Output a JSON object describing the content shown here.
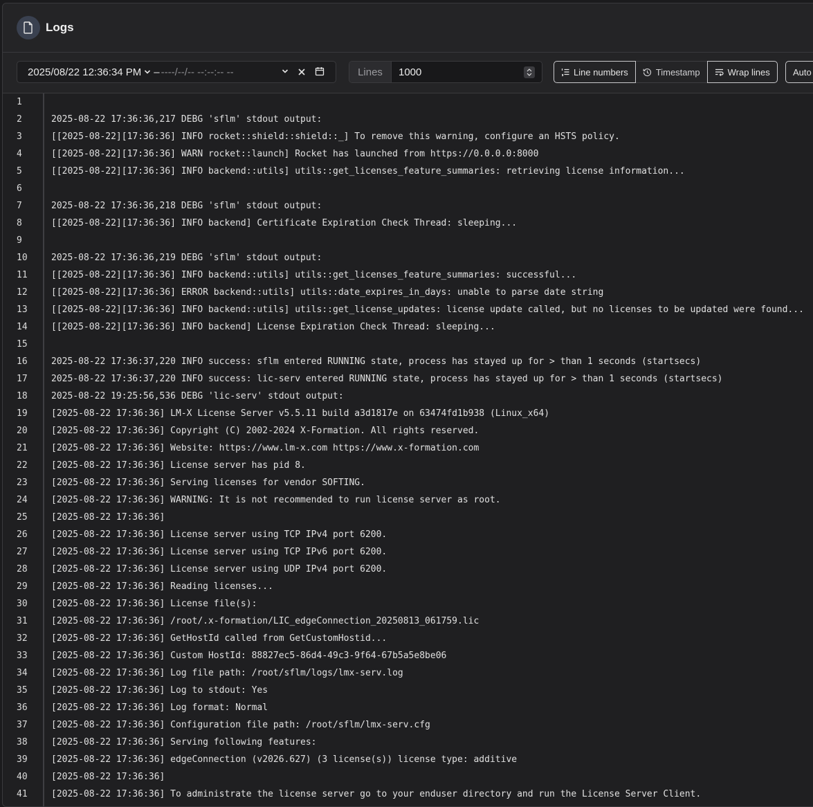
{
  "header": {
    "title": "Logs",
    "icon": "file-icon"
  },
  "toolbar": {
    "date_value": "2025/08/22 12:36:34 PM",
    "date_separator": "–",
    "date_end_placeholder": "----/--/-- --:--:-- --",
    "lines_label": "Lines",
    "lines_value": "1000",
    "btn_line_numbers": "Line numbers",
    "btn_timestamp": "Timestamp",
    "btn_wrap_lines": "Wrap lines",
    "btn_auto": "Auto"
  },
  "log": [
    {
      "n": "1",
      "t": ""
    },
    {
      "n": "2",
      "t": "2025-08-22 17:36:36,217 DEBG 'sflm' stdout output:"
    },
    {
      "n": "3",
      "t": "[[2025-08-22][17:36:36] INFO rocket::shield::shield::_] To remove this warning, configure an HSTS policy."
    },
    {
      "n": "4",
      "t": "[[2025-08-22][17:36:36] WARN rocket::launch] Rocket has launched from https://0.0.0.0:8000"
    },
    {
      "n": "5",
      "t": "[[2025-08-22][17:36:36] INFO backend::utils] utils::get_licenses_feature_summaries: retrieving license information..."
    },
    {
      "n": "6",
      "t": ""
    },
    {
      "n": "7",
      "t": "2025-08-22 17:36:36,218 DEBG 'sflm' stdout output:"
    },
    {
      "n": "8",
      "t": "[[2025-08-22][17:36:36] INFO backend] Certificate Expiration Check Thread: sleeping..."
    },
    {
      "n": "9",
      "t": ""
    },
    {
      "n": "10",
      "t": "2025-08-22 17:36:36,219 DEBG 'sflm' stdout output:"
    },
    {
      "n": "11",
      "t": "[[2025-08-22][17:36:36] INFO backend::utils] utils::get_licenses_feature_summaries: successful..."
    },
    {
      "n": "12",
      "t": "[[2025-08-22][17:36:36] ERROR backend::utils] utils::date_expires_in_days: unable to parse date string"
    },
    {
      "n": "13",
      "t": "[[2025-08-22][17:36:36] INFO backend::utils] utils::get_license_updates: license update called, but no licenses to be updated were found..."
    },
    {
      "n": "14",
      "t": "[[2025-08-22][17:36:36] INFO backend] License Expiration Check Thread: sleeping..."
    },
    {
      "n": "15",
      "t": ""
    },
    {
      "n": "16",
      "t": "2025-08-22 17:36:37,220 INFO success: sflm entered RUNNING state, process has stayed up for > than 1 seconds (startsecs)"
    },
    {
      "n": "17",
      "t": "2025-08-22 17:36:37,220 INFO success: lic-serv entered RUNNING state, process has stayed up for > than 1 seconds (startsecs)"
    },
    {
      "n": "18",
      "t": "2025-08-22 19:25:56,536 DEBG 'lic-serv' stdout output:"
    },
    {
      "n": "19",
      "t": "[2025-08-22 17:36:36] LM-X License Server v5.5.11 build a3d1817e on 63474fd1b938 (Linux_x64)"
    },
    {
      "n": "20",
      "t": "[2025-08-22 17:36:36] Copyright (C) 2002-2024 X-Formation. All rights reserved."
    },
    {
      "n": "21",
      "t": "[2025-08-22 17:36:36] Website: https://www.lm-x.com https://www.x-formation.com"
    },
    {
      "n": "22",
      "t": "[2025-08-22 17:36:36] License server has pid 8."
    },
    {
      "n": "23",
      "t": "[2025-08-22 17:36:36] Serving licenses for vendor SOFTING."
    },
    {
      "n": "24",
      "t": "[2025-08-22 17:36:36] WARNING: It is not recommended to run license server as root."
    },
    {
      "n": "25",
      "t": "[2025-08-22 17:36:36]"
    },
    {
      "n": "26",
      "t": "[2025-08-22 17:36:36] License server using TCP IPv4 port 6200."
    },
    {
      "n": "27",
      "t": "[2025-08-22 17:36:36] License server using TCP IPv6 port 6200."
    },
    {
      "n": "28",
      "t": "[2025-08-22 17:36:36] License server using UDP IPv4 port 6200."
    },
    {
      "n": "29",
      "t": "[2025-08-22 17:36:36] Reading licenses..."
    },
    {
      "n": "30",
      "t": "[2025-08-22 17:36:36] License file(s):"
    },
    {
      "n": "31",
      "t": "[2025-08-22 17:36:36] /root/.x-formation/LIC_edgeConnection_20250813_061759.lic"
    },
    {
      "n": "32",
      "t": "[2025-08-22 17:36:36] GetHostId called from GetCustomHostid..."
    },
    {
      "n": "33",
      "t": "[2025-08-22 17:36:36] Custom HostId: 88827ec5-86d4-49c3-9f64-67b5a5e8be06"
    },
    {
      "n": "34",
      "t": "[2025-08-22 17:36:36] Log file path: /root/sflm/logs/lmx-serv.log"
    },
    {
      "n": "35",
      "t": "[2025-08-22 17:36:36] Log to stdout: Yes"
    },
    {
      "n": "36",
      "t": "[2025-08-22 17:36:36] Log format: Normal"
    },
    {
      "n": "37",
      "t": "[2025-08-22 17:36:36] Configuration file path: /root/sflm/lmx-serv.cfg"
    },
    {
      "n": "38",
      "t": "[2025-08-22 17:36:36] Serving following features:"
    },
    {
      "n": "39",
      "t": "[2025-08-22 17:36:36] edgeConnection (v2026.627) (3 license(s)) license type: additive"
    },
    {
      "n": "40",
      "t": "[2025-08-22 17:36:36]"
    },
    {
      "n": "41",
      "t": "[2025-08-22 17:36:36] To administrate the license server go to your enduser directory and run the License Server Client."
    }
  ]
}
